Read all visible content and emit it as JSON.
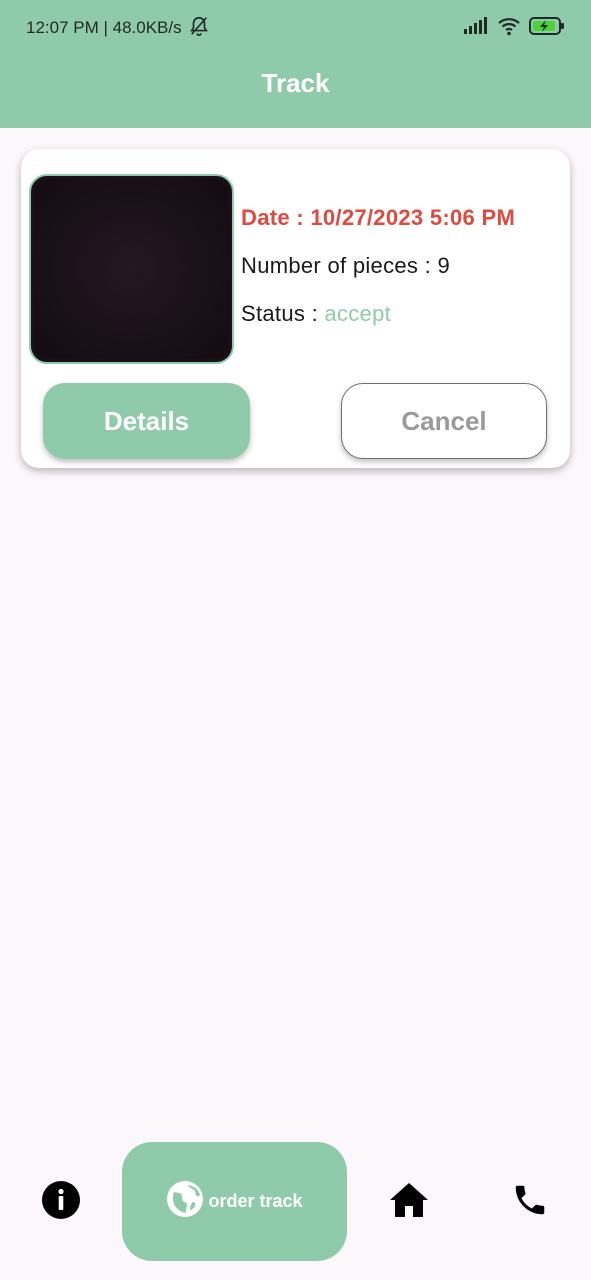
{
  "status_bar": {
    "time_speed": "12:07 PM | 48.0KB/s",
    "icons": [
      "bell-off-icon",
      "signal-icon",
      "wifi-icon",
      "battery-charging-icon"
    ]
  },
  "app_bar": {
    "title": "Track"
  },
  "order": {
    "date": "Date : 10/27/2023 5:06 PM",
    "pieces_label": "Number of pieces : ",
    "pieces_value": "9",
    "status_label": "Status : ",
    "status_value": "accept",
    "details_button": "Details",
    "cancel_button": "Cancel"
  },
  "bottom_nav": {
    "items": [
      {
        "icon": "info-icon"
      },
      {
        "icon": "globe-icon",
        "label": "order track"
      },
      {
        "icon": "home-icon"
      },
      {
        "icon": "phone-icon"
      }
    ]
  },
  "colors": {
    "accent": "#8fcbab",
    "date_red": "#e04a3e",
    "background": "#fcf7fb"
  }
}
